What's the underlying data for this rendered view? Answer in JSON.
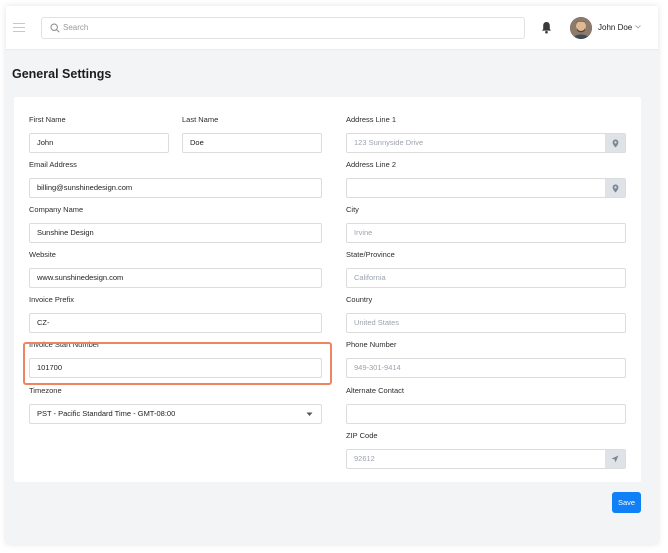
{
  "header": {
    "search_placeholder": "Search",
    "user_name": "John Doe"
  },
  "page": {
    "title": "General Settings"
  },
  "form": {
    "first_name": {
      "label": "First Name",
      "value": "John"
    },
    "last_name": {
      "label": "Last Name",
      "value": "Doe"
    },
    "email": {
      "label": "Email Address",
      "value": "billing@sunshinedesign.com"
    },
    "company": {
      "label": "Company Name",
      "value": "Sunshine Design"
    },
    "website": {
      "label": "Website",
      "value": "www.sunshinedesign.com"
    },
    "invoice_prefix": {
      "label": "Invoice Prefix",
      "value": "CZ-"
    },
    "invoice_start": {
      "label": "Invoice Start Number",
      "value": "101700"
    },
    "timezone": {
      "label": "Timezone",
      "value": "PST - Pacific Standard Time - GMT-08:00"
    },
    "address1": {
      "label": "Address Line 1",
      "placeholder": "123 Sunnyside Drive"
    },
    "address2": {
      "label": "Address Line 2",
      "value": ""
    },
    "city": {
      "label": "City",
      "placeholder": "Irvine"
    },
    "state": {
      "label": "State/Province",
      "placeholder": "California"
    },
    "country": {
      "label": "Country",
      "placeholder": "United States"
    },
    "phone": {
      "label": "Phone Number",
      "placeholder": "949-301-9414"
    },
    "alt_contact": {
      "label": "Alternate Contact",
      "value": ""
    },
    "zip": {
      "label": "ZIP Code",
      "placeholder": "92612"
    }
  },
  "actions": {
    "save_label": "Save"
  },
  "colors": {
    "accent": "#0f80f5",
    "highlight": "#ef8560",
    "addon": "#dfe3e8"
  }
}
